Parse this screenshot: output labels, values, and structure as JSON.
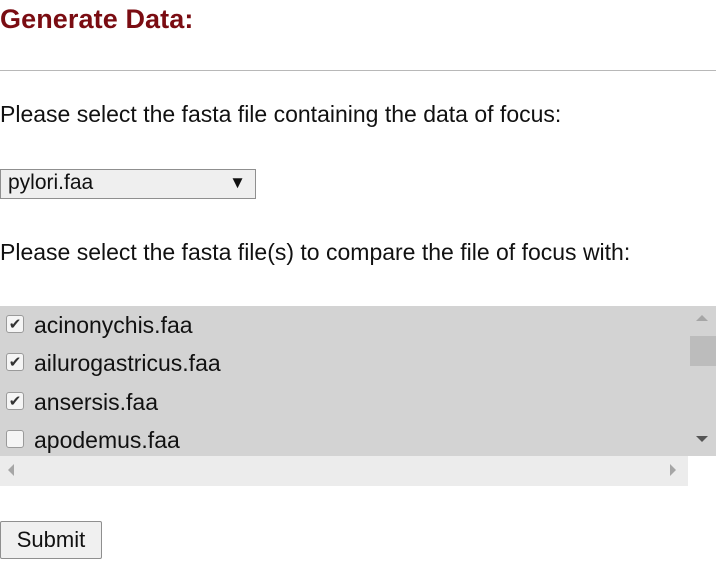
{
  "heading": "Generate Data:",
  "focus_prompt": "Please select the fasta file containing the data of focus:",
  "focus_select": {
    "value": "pylori.faa",
    "arrow_icon": "triangle-down-icon"
  },
  "compare_prompt": "Please select the fasta file(s) to compare the file of focus with:",
  "compare_list": {
    "items": [
      {
        "label": "acinonychis.faa",
        "checked": true,
        "check": "✔"
      },
      {
        "label": "ailurogastricus.faa",
        "checked": true,
        "check": "✔"
      },
      {
        "label": "ansersis.faa",
        "checked": true,
        "check": "✔"
      },
      {
        "label": "apodemus.faa",
        "checked": false,
        "check": ""
      }
    ],
    "list_background": "#d3d3d3"
  },
  "submit_label": "Submit",
  "colors": {
    "heading": "#7a0c12"
  }
}
